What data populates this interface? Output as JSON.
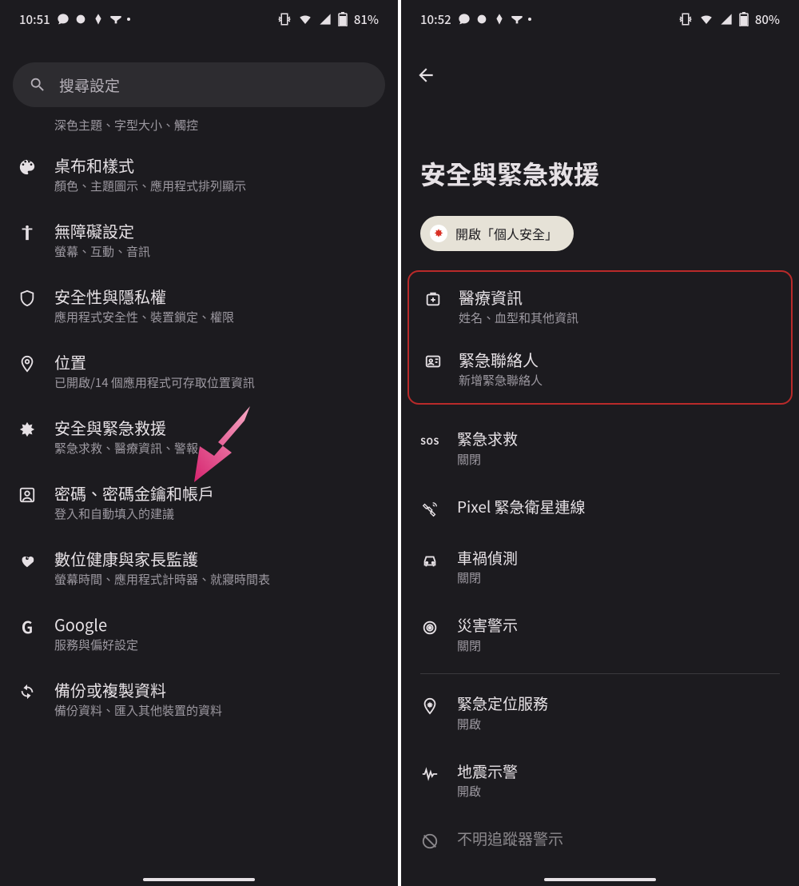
{
  "left": {
    "status": {
      "time": "10:51",
      "battery": "81%"
    },
    "search_placeholder": "搜尋設定",
    "partial_sub": "深色主題、字型大小、觸控",
    "items": [
      {
        "title": "桌布和樣式",
        "sub": "顏色、主題圖示、應用程式排列顯示"
      },
      {
        "title": "無障礙設定",
        "sub": "螢幕、互動、音訊"
      },
      {
        "title": "安全性與隱私權",
        "sub": "應用程式安全性、裝置鎖定、權限"
      },
      {
        "title": "位置",
        "sub": "已開啟/14 個應用程式可存取位置資訊"
      },
      {
        "title": "安全與緊急救援",
        "sub": "緊急求救、醫療資訊、警報"
      },
      {
        "title": "密碼、密碼金鑰和帳戶",
        "sub": "登入和自動填入的建議"
      },
      {
        "title": "數位健康與家長監護",
        "sub": "螢幕時間、應用程式計時器、就寢時間表"
      },
      {
        "title": "Google",
        "sub": "服務與偏好設定"
      },
      {
        "title": "備份或複製資料",
        "sub": "備份資料、匯入其他裝置的資料"
      }
    ]
  },
  "right": {
    "status": {
      "time": "10:52",
      "battery": "80%"
    },
    "page_title": "安全與緊急救援",
    "chip_label": "開啟「個人安全」",
    "highlight": [
      {
        "title": "醫療資訊",
        "sub": "姓名、血型和其他資訊"
      },
      {
        "title": "緊急聯絡人",
        "sub": "新增緊急聯絡人"
      }
    ],
    "items": [
      {
        "title": "緊急求救",
        "sub": "關閉"
      },
      {
        "title": "Pixel 緊急衛星連線",
        "sub": ""
      },
      {
        "title": "車禍偵測",
        "sub": "關閉"
      },
      {
        "title": "災害警示",
        "sub": "關閉"
      }
    ],
    "items2": [
      {
        "title": "緊急定位服務",
        "sub": "開啟"
      },
      {
        "title": "地震示警",
        "sub": "開啟"
      },
      {
        "title": "不明追蹤器警示",
        "sub": ""
      }
    ]
  }
}
